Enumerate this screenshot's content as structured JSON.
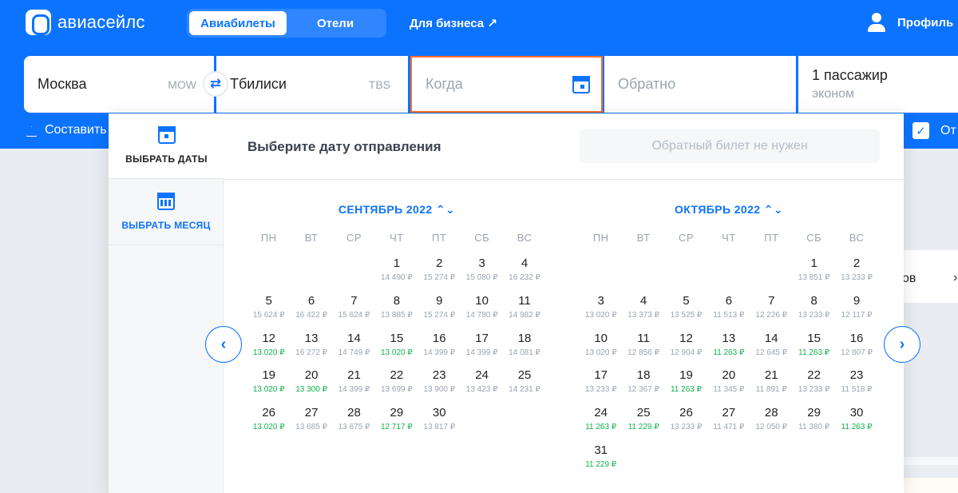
{
  "header": {
    "logo_text": "авиасейлс",
    "tabs": [
      {
        "label": "Авиабилеты"
      },
      {
        "label": "Отели"
      }
    ],
    "business_link": "Для бизнеса ↗",
    "profile_label": "Профиль"
  },
  "search": {
    "origin": {
      "city": "Москва",
      "iata": "MOW"
    },
    "destination": {
      "city": "Тбилиси",
      "iata": "TBS"
    },
    "when_placeholder": "Когда",
    "return_placeholder": "Обратно",
    "passengers": {
      "count": "1 пассажир",
      "class": "эконом"
    },
    "compose_route_label": "Составить",
    "right_checkbox_label": "От"
  },
  "background": {
    "partial_text": "ов",
    "partial_chevron": "›"
  },
  "date_picker": {
    "nav": {
      "dates_label": "ВЫБРАТЬ ДАТЫ",
      "month_label": "ВЫБРАТЬ МЕСЯЦ"
    },
    "title": "Выберите дату отправления",
    "no_return_button": "Обратный билет не нужен",
    "prev_arrow": "‹",
    "next_arrow": "›",
    "weekdays": [
      "ПН",
      "ВТ",
      "СР",
      "ЧТ",
      "ПТ",
      "СБ",
      "ВС"
    ],
    "months": [
      {
        "title": "СЕНТЯБРЬ 2022 ⌃⌄",
        "offset": 3,
        "days": [
          {
            "d": "1",
            "price": "14 490 ₽",
            "cheap": false
          },
          {
            "d": "2",
            "price": "15 274 ₽",
            "cheap": false
          },
          {
            "d": "3",
            "price": "15 080 ₽",
            "cheap": false
          },
          {
            "d": "4",
            "price": "16 232 ₽",
            "cheap": false
          },
          {
            "d": "5",
            "price": "15 624 ₽",
            "cheap": false
          },
          {
            "d": "6",
            "price": "16 422 ₽",
            "cheap": false
          },
          {
            "d": "7",
            "price": "15 624 ₽",
            "cheap": false
          },
          {
            "d": "8",
            "price": "13 885 ₽",
            "cheap": false
          },
          {
            "d": "9",
            "price": "15 274 ₽",
            "cheap": false
          },
          {
            "d": "10",
            "price": "14 780 ₽",
            "cheap": false
          },
          {
            "d": "11",
            "price": "14 982 ₽",
            "cheap": false
          },
          {
            "d": "12",
            "price": "13 020 ₽",
            "cheap": true
          },
          {
            "d": "13",
            "price": "16 272 ₽",
            "cheap": false
          },
          {
            "d": "14",
            "price": "14 749 ₽",
            "cheap": false
          },
          {
            "d": "15",
            "price": "13 020 ₽",
            "cheap": true
          },
          {
            "d": "16",
            "price": "14 399 ₽",
            "cheap": false
          },
          {
            "d": "17",
            "price": "14 399 ₽",
            "cheap": false
          },
          {
            "d": "18",
            "price": "14 081 ₽",
            "cheap": false
          },
          {
            "d": "19",
            "price": "13 020 ₽",
            "cheap": true
          },
          {
            "d": "20",
            "price": "13 300 ₽",
            "cheap": true
          },
          {
            "d": "21",
            "price": "14 399 ₽",
            "cheap": false
          },
          {
            "d": "22",
            "price": "13 699 ₽",
            "cheap": false
          },
          {
            "d": "23",
            "price": "13 900 ₽",
            "cheap": false
          },
          {
            "d": "24",
            "price": "13 423 ₽",
            "cheap": false
          },
          {
            "d": "25",
            "price": "14 231 ₽",
            "cheap": false
          },
          {
            "d": "26",
            "price": "13 020 ₽",
            "cheap": true
          },
          {
            "d": "27",
            "price": "13 685 ₽",
            "cheap": false
          },
          {
            "d": "28",
            "price": "13 675 ₽",
            "cheap": false
          },
          {
            "d": "29",
            "price": "12 717 ₽",
            "cheap": true
          },
          {
            "d": "30",
            "price": "13 817 ₽",
            "cheap": false
          }
        ]
      },
      {
        "title": "ОКТЯБРЬ 2022 ⌃⌄",
        "offset": 5,
        "days": [
          {
            "d": "1",
            "price": "13 851 ₽",
            "cheap": false
          },
          {
            "d": "2",
            "price": "13 233 ₽",
            "cheap": false
          },
          {
            "d": "3",
            "price": "13 020 ₽",
            "cheap": false
          },
          {
            "d": "4",
            "price": "13 373 ₽",
            "cheap": false
          },
          {
            "d": "5",
            "price": "13 525 ₽",
            "cheap": false
          },
          {
            "d": "6",
            "price": "11 513 ₽",
            "cheap": false
          },
          {
            "d": "7",
            "price": "12 226 ₽",
            "cheap": false
          },
          {
            "d": "8",
            "price": "13 233 ₽",
            "cheap": false
          },
          {
            "d": "9",
            "price": "12 117 ₽",
            "cheap": false
          },
          {
            "d": "10",
            "price": "13 020 ₽",
            "cheap": false
          },
          {
            "d": "11",
            "price": "12 856 ₽",
            "cheap": false
          },
          {
            "d": "12",
            "price": "12 904 ₽",
            "cheap": false
          },
          {
            "d": "13",
            "price": "11 263 ₽",
            "cheap": true
          },
          {
            "d": "14",
            "price": "12 645 ₽",
            "cheap": false
          },
          {
            "d": "15",
            "price": "11 263 ₽",
            "cheap": true
          },
          {
            "d": "16",
            "price": "12 807 ₽",
            "cheap": false
          },
          {
            "d": "17",
            "price": "13 233 ₽",
            "cheap": false
          },
          {
            "d": "18",
            "price": "12 367 ₽",
            "cheap": false
          },
          {
            "d": "19",
            "price": "11 263 ₽",
            "cheap": true
          },
          {
            "d": "20",
            "price": "11 345 ₽",
            "cheap": false
          },
          {
            "d": "21",
            "price": "11 891 ₽",
            "cheap": false
          },
          {
            "d": "22",
            "price": "13 233 ₽",
            "cheap": false
          },
          {
            "d": "23",
            "price": "11 518 ₽",
            "cheap": false
          },
          {
            "d": "24",
            "price": "11 263 ₽",
            "cheap": true
          },
          {
            "d": "25",
            "price": "11 229 ₽",
            "cheap": true
          },
          {
            "d": "26",
            "price": "13 233 ₽",
            "cheap": false
          },
          {
            "d": "27",
            "price": "11 471 ₽",
            "cheap": false
          },
          {
            "d": "28",
            "price": "12 050 ₽",
            "cheap": false
          },
          {
            "d": "29",
            "price": "11 380 ₽",
            "cheap": false
          },
          {
            "d": "30",
            "price": "11 263 ₽",
            "cheap": true
          },
          {
            "d": "31",
            "price": "11 229 ₽",
            "cheap": true
          }
        ]
      }
    ]
  },
  "colors": {
    "brand_blue": "#0c73fe",
    "cheap_green": "#10b04a",
    "active_field_border": "#ff6b2c"
  }
}
